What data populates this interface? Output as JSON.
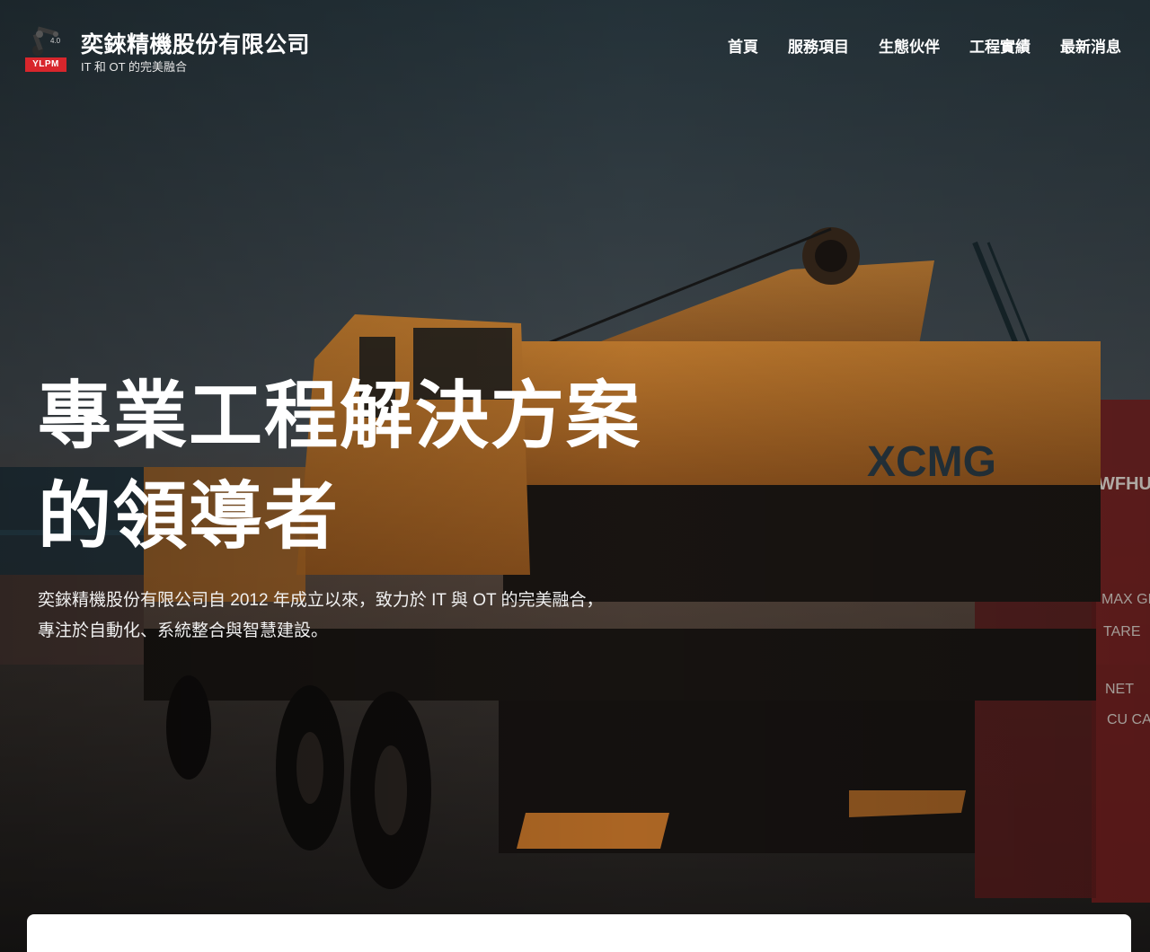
{
  "brand": {
    "logo_badge": "YLPM",
    "title": "奕錸精機股份有限公司",
    "subtitle": "IT 和 OT 的完美融合"
  },
  "nav": {
    "items": [
      {
        "label": "首頁"
      },
      {
        "label": "服務項目"
      },
      {
        "label": "生態伙伴"
      },
      {
        "label": "工程實績"
      },
      {
        "label": "最新消息"
      }
    ]
  },
  "hero": {
    "headline_line1": "專業工程解決方案",
    "headline_line2": "的領導者",
    "desc_line1": "奕錸精機股份有限公司自 2012 年成立以來，致力於 IT 與 OT 的完美融合，",
    "desc_line2": "專注於自動化、系統整合與智慧建設。",
    "image": {
      "truck_brand": "XCMG",
      "container_texts": [
        "WFHU",
        "MAX GROS",
        "TARE",
        "NET",
        "CU CAP."
      ]
    }
  },
  "colors": {
    "brand_red": "#d8262c",
    "crane_orange": "#c9772a",
    "text_white": "#ffffff"
  }
}
